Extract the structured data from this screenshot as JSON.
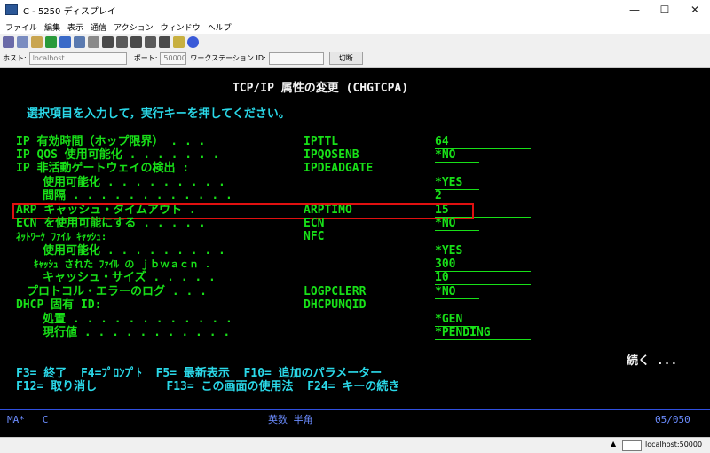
{
  "window": {
    "title": "C - 5250 ディスプレイ",
    "minimize": "—",
    "maximize": "☐",
    "close": "✕"
  },
  "menu": [
    "ファイル",
    "編集",
    "表示",
    "通信",
    "アクション",
    "ウィンドウ",
    "ヘルプ"
  ],
  "toolbar_icons": [
    "print-icon",
    "copy-icon",
    "paste-icon",
    "download-icon",
    "display-icon",
    "keyboard-icon",
    "macro-icon",
    "record-icon",
    "stop-icon",
    "play-icon",
    "send-icon",
    "receive-icon",
    "notes-icon",
    "help-icon"
  ],
  "hostbar": {
    "host_label": "ホスト:",
    "host_value": "localhost",
    "port_label": "ポート:",
    "port_value": "50000",
    "ws_label": "ワークステーション ID:",
    "ws_value": "",
    "disconnect": "切断"
  },
  "screen": {
    "title": "TCP/IP 属性の変更 (CHGTCPA)",
    "instruction": "選択項目を入力して，実行キーを押してください。",
    "rows": [
      {
        "label": "IP 有効時間（ホップ限界） . . .",
        "keyword": "IPTTL",
        "value": "64"
      },
      {
        "label": "IP QOS 使用可能化 . . . . . . .",
        "keyword": "IPQOSENB",
        "value": "*NO"
      },
      {
        "label": "IP 非活動ゲートウェイの検出 :",
        "keyword": "IPDEADGATE",
        "value": ""
      },
      {
        "label": "使用可能化 . . . . . . . . .",
        "keyword": "",
        "value": "*YES"
      },
      {
        "label": "間隔 . . . . . . . . . . . .",
        "keyword": "",
        "value": "2"
      },
      {
        "label": "ARP キャッシュ・タイムアウト .",
        "keyword": "ARPTIMO",
        "value": "15"
      },
      {
        "label": "ECN を使用可能にする . . . . .",
        "keyword": "ECN",
        "value": "*NO"
      },
      {
        "label": "ﾈｯﾄﾜｰｸ ﾌｧｲﾙ ｷｬｯｼｭ:",
        "keyword": "NFC",
        "value": ""
      },
      {
        "label": "使用可能化 . . . . . . . . .",
        "keyword": "",
        "value": "*YES"
      },
      {
        "label": "ｷｬｯｼｭ された ﾌｧｲﾙ の ｊｂｗａｃｎ .",
        "keyword": "",
        "value": "300"
      },
      {
        "label": "キャッシュ・サイズ . . . . .",
        "keyword": "",
        "value": "10"
      },
      {
        "label": "プロトコル・エラーのログ . . .",
        "keyword": "LOGPCLERR",
        "value": "*NO"
      },
      {
        "label": "DHCP 固有 ID:",
        "keyword": "DHCPUNQID",
        "value": ""
      },
      {
        "label": "処置 . . . . . . . . . . . .",
        "keyword": "",
        "value": "*GEN"
      },
      {
        "label": "現行値 . . . . . . . . . . .",
        "keyword": "",
        "value": "*PENDING"
      }
    ],
    "more": "続く ...",
    "fkeys_line1": "F3= 終了  F4=ﾌﾟﾛﾝﾌﾟﾄ  F5= 最新表示  F10= 追加のパラメーター",
    "fkeys_line2": "F12= 取り消し          F13= この画面の使用法  F24= キーの続き",
    "status_left": "MA*   C",
    "status_mid": "英数 半角",
    "status_right": "05/050"
  },
  "status": {
    "arrow": "▲",
    "host": "localhost:50000"
  },
  "colors": {
    "terminal_bg": "#000000",
    "field_green": "#18e018",
    "label_cyan": "#2ad8e8",
    "title_white": "#f2f2f2",
    "highlight_red": "#e01010"
  }
}
